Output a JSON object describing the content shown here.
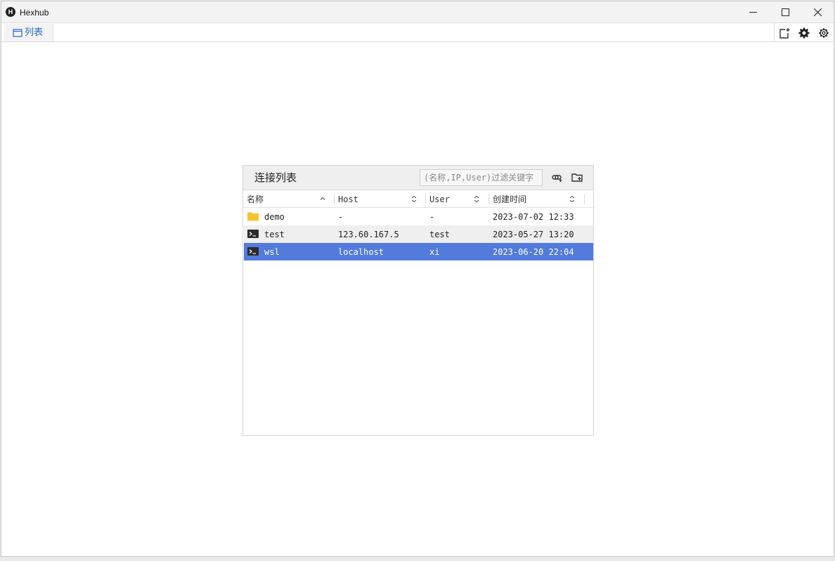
{
  "window": {
    "app_icon_letter": "H",
    "title": "Hexhub"
  },
  "tabs": [
    {
      "label": "列表"
    }
  ],
  "panel": {
    "title": "连接列表",
    "search": {
      "value": "",
      "placeholder": "(名称,IP,User)过滤关键字"
    },
    "columns": [
      {
        "label": "名称",
        "sort": "ascending"
      },
      {
        "label": "Host",
        "sort": "none"
      },
      {
        "label": "User",
        "sort": "none"
      },
      {
        "label": "创建时间",
        "sort": "none"
      }
    ],
    "rows": [
      {
        "type": "folder",
        "icon": "folder-icon",
        "name": "demo",
        "host": "-",
        "user": "-",
        "created": "2023-07-02 12:33"
      },
      {
        "type": "terminal",
        "icon": "terminal-icon",
        "name": "test",
        "host": "123.60.167.5",
        "user": "test",
        "created": "2023-05-27 13:20"
      },
      {
        "type": "terminal",
        "icon": "terminal-icon",
        "name": "wsl",
        "host": "localhost",
        "user": "xi",
        "created": "2023-06-20 22:04",
        "selected": true
      }
    ]
  },
  "colors": {
    "accent": "#2b6cc4",
    "selected_row": "#527bdc",
    "folder": "#f6c32c"
  }
}
